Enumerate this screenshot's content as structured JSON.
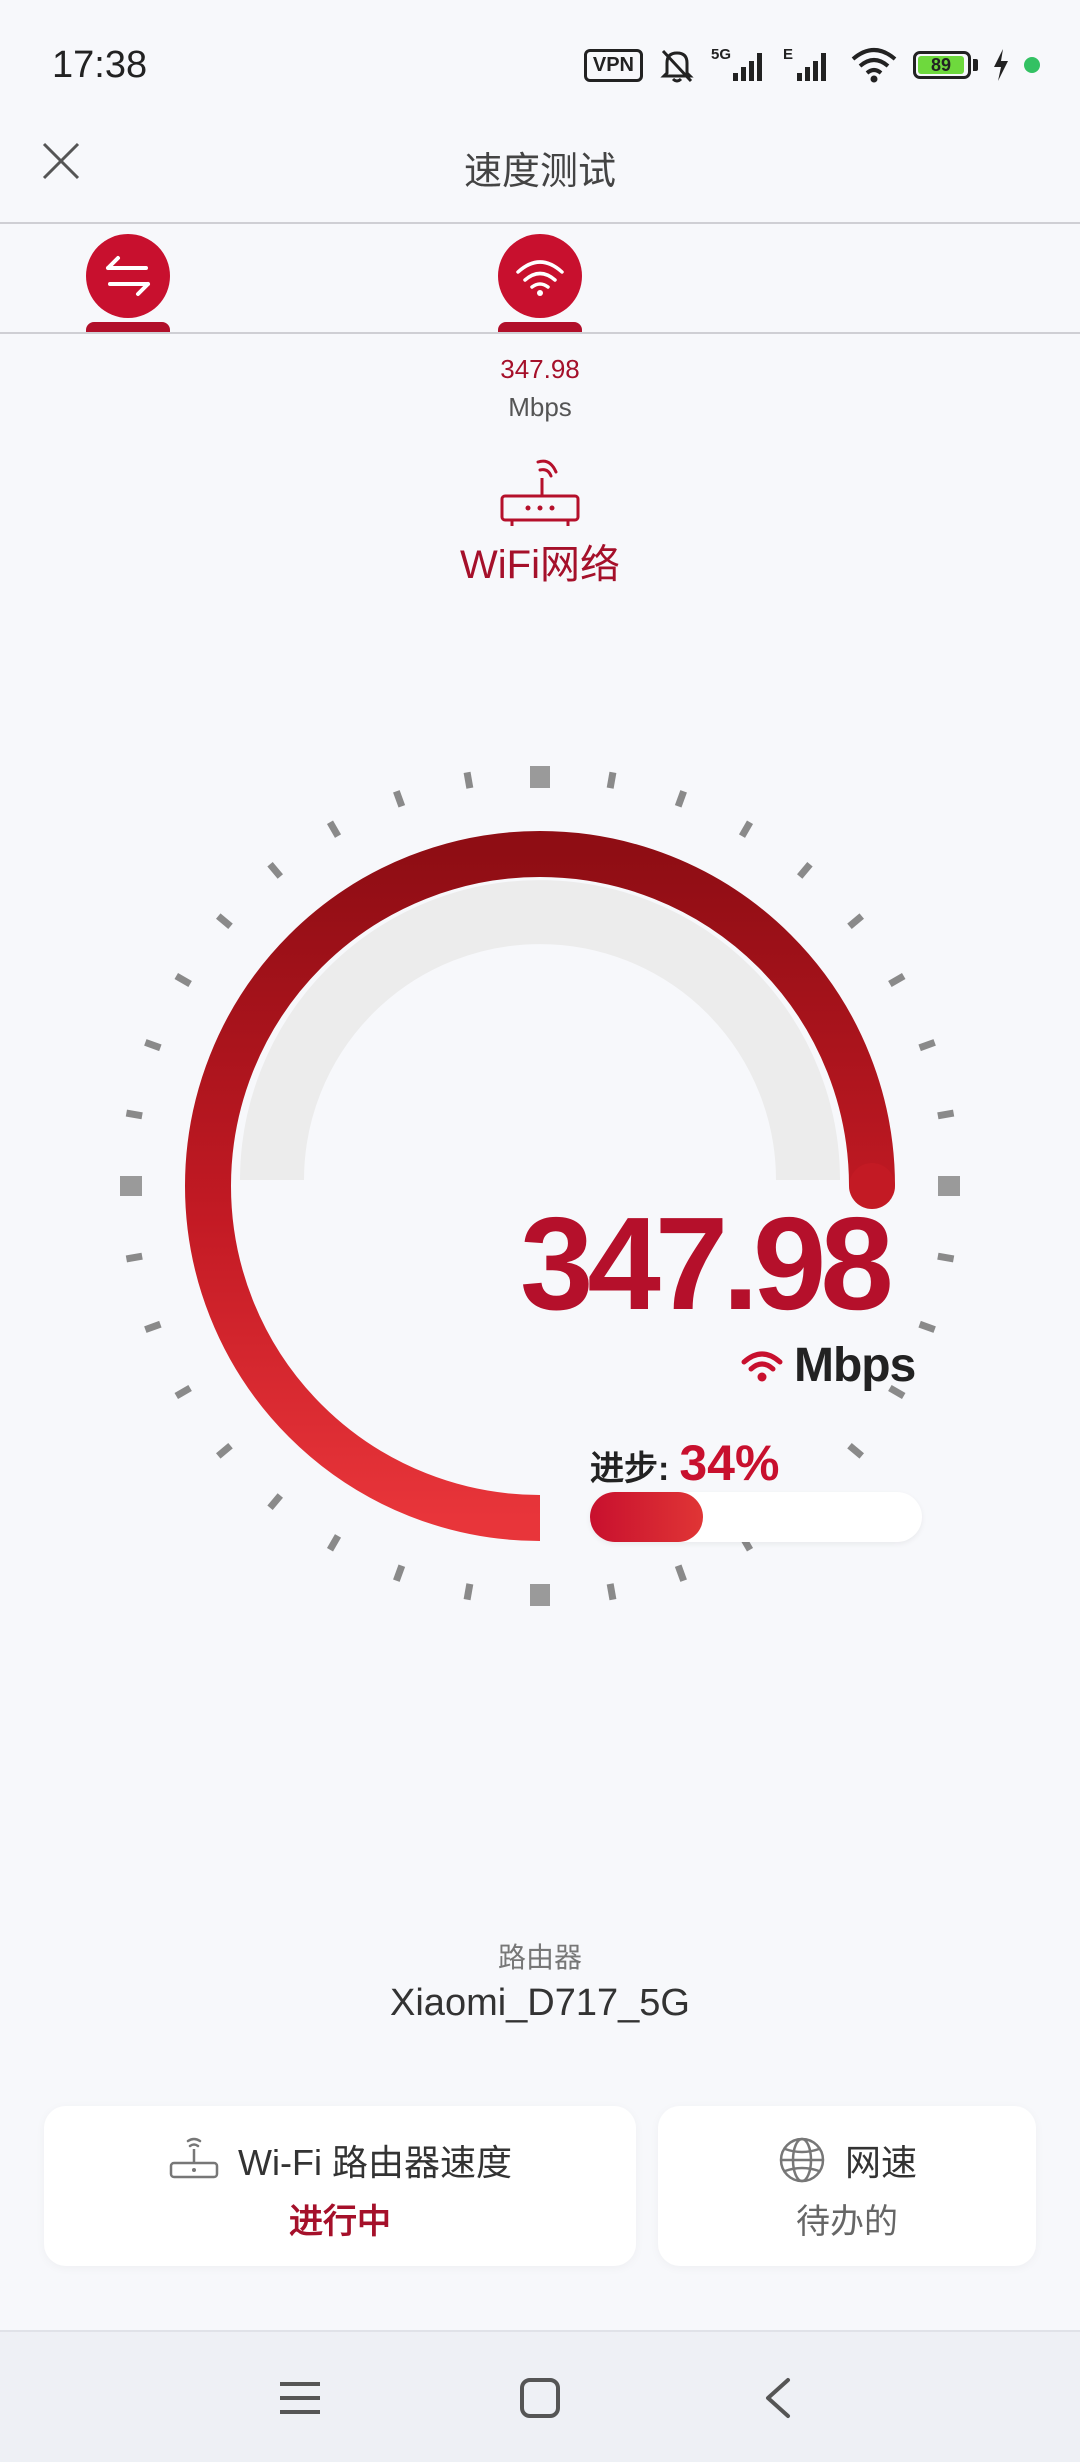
{
  "status_bar": {
    "time": "17:38",
    "vpn_label": "VPN",
    "battery_level": "89",
    "icons": [
      "vpn-icon",
      "mute-bell-icon",
      "signal-5g-icon",
      "signal-e-icon",
      "wifi-icon",
      "battery-icon",
      "charging-icon",
      "privacy-dot-icon"
    ]
  },
  "header": {
    "title": "速度测试"
  },
  "summary": {
    "speed": "347.98",
    "unit": "Mbps",
    "network_label": "WiFi网络"
  },
  "gauge": {
    "speed": "347.98",
    "unit": "Mbps",
    "progress_label": "进步:",
    "progress_text": "34%",
    "progress_value": 0.34,
    "accent": "#c8102e"
  },
  "router": {
    "caption": "路由器",
    "name": "Xiaomi_D717_5G"
  },
  "cards": [
    {
      "title": "Wi-Fi 路由器速度",
      "status": "进行中",
      "icon": "router-icon"
    },
    {
      "title": "网速",
      "status": "待办的",
      "icon": "globe-icon"
    }
  ],
  "nav": {
    "icons": [
      "menu-icon",
      "home-icon",
      "back-icon"
    ]
  },
  "colors": {
    "accent": "#c8102e",
    "accent_dark": "#a5102a",
    "background": "#f7f8fb"
  }
}
